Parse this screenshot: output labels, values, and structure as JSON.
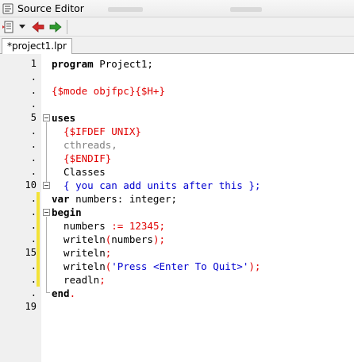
{
  "window": {
    "title": "Source Editor"
  },
  "toolbar": {
    "buttons": [
      {
        "name": "code-tools-menu-icon"
      },
      {
        "name": "dropdown-arrow-icon"
      },
      {
        "name": "back-arrow-icon",
        "color": "#d22b2b"
      },
      {
        "name": "forward-arrow-icon",
        "color": "#2e9a2e"
      }
    ]
  },
  "tabs": [
    {
      "label": "*project1.lpr",
      "active": true
    }
  ],
  "editor": {
    "colors": {
      "gutter_bg": "#f0f0f0",
      "modified_marker": "#f3e236",
      "directive": "#e00000",
      "comment": "#0000d0",
      "number": "#e00000",
      "string": "#0000d0"
    },
    "gutter": [
      "1",
      ".",
      ".",
      ".",
      "5",
      ".",
      ".",
      ".",
      ".",
      "10",
      ".",
      ".",
      ".",
      ".",
      "15",
      ".",
      ".",
      ".",
      "19"
    ],
    "lines": [
      {
        "t1": "program",
        "t2": " Project1;"
      },
      {
        "t1": ""
      },
      {
        "t1": "{$mode objfpc}{$H+}"
      },
      {
        "t1": ""
      },
      {
        "t1": "uses"
      },
      {
        "t1": "  {$IFDEF UNIX}"
      },
      {
        "t1": "  cthreads,"
      },
      {
        "t1": "  {$ENDIF}"
      },
      {
        "t1": "  Classes"
      },
      {
        "t1": "  { you can add units after this };"
      },
      {
        "t1": "var",
        "t2": " numbers: integer;"
      },
      {
        "t1": "begin"
      },
      {
        "t1": "  numbers ",
        "t2": ":=",
        "t3": " 12345",
        "t4": ";"
      },
      {
        "t1": "  writeln",
        "t2": "(",
        "t3": "numbers",
        "t4": ");"
      },
      {
        "t1": "  writeln",
        "t2": ";"
      },
      {
        "t1": "  writeln",
        "t2": "(",
        "t3": "'Press <Enter To Quit>'",
        "t4": ");"
      },
      {
        "t1": "  readln",
        "t2": ";"
      },
      {
        "t1": "end",
        "t2": "."
      },
      {
        "t1": ""
      }
    ]
  }
}
